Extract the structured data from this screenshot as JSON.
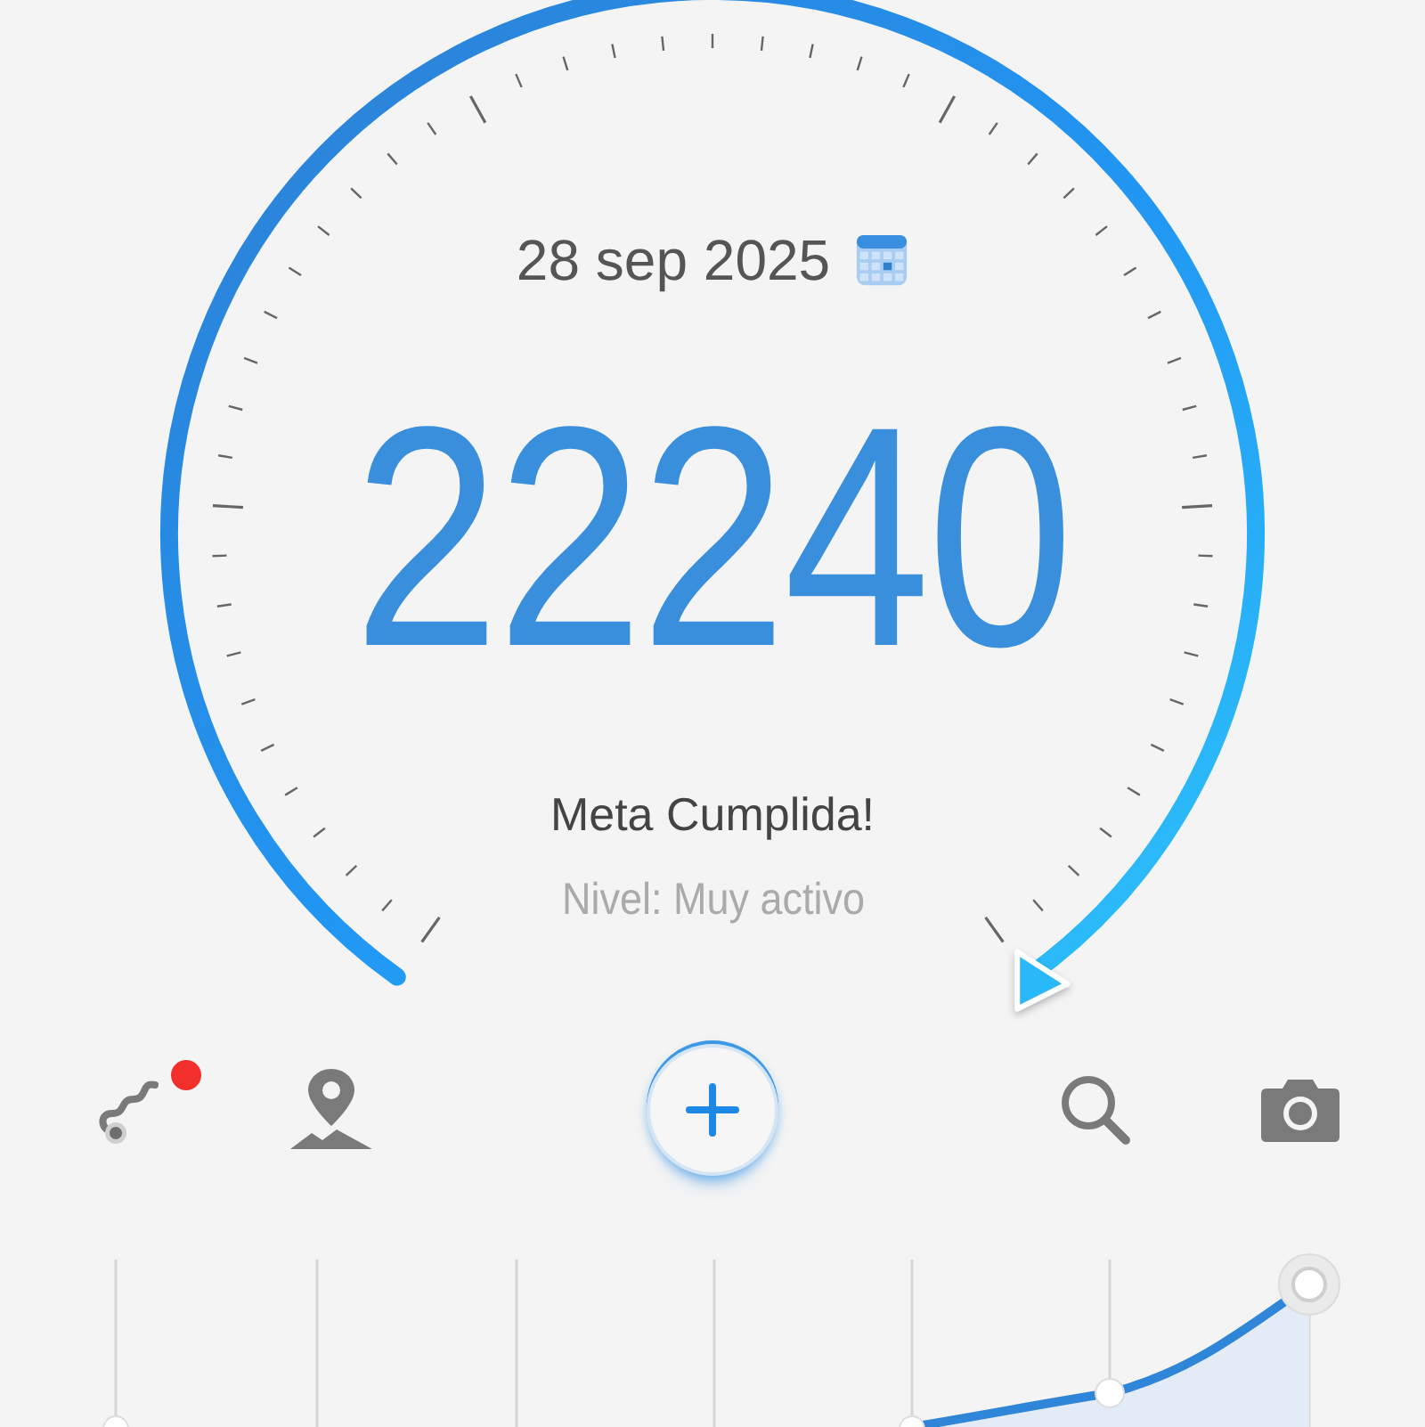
{
  "gauge": {
    "date": "28 sep 2025",
    "steps": "22240",
    "status": "Meta Cumplida!",
    "activity": "Nivel: Muy activo"
  },
  "toolbar": [
    {
      "kind": "route",
      "badge": true
    },
    {
      "kind": "map",
      "badge": false
    },
    {
      "kind": "add",
      "badge": false
    },
    {
      "kind": "search",
      "badge": false
    },
    {
      "kind": "camera",
      "badge": false
    }
  ]
}
